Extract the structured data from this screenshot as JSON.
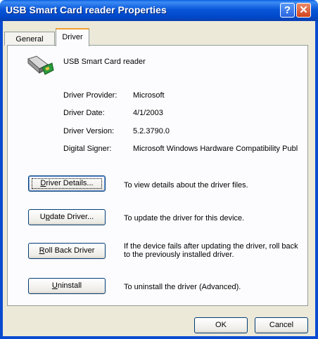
{
  "window": {
    "title": "USB Smart Card reader Properties"
  },
  "titlebar": {
    "help_glyph": "?",
    "close_glyph": "✕"
  },
  "tabs": [
    {
      "label": "General",
      "selected": false
    },
    {
      "label": "Driver",
      "selected": true
    }
  ],
  "device": {
    "icon": "smart-card-reader-icon",
    "name": "USB Smart Card reader"
  },
  "properties": [
    {
      "label": "Driver Provider:",
      "value": "Microsoft"
    },
    {
      "label": "Driver Date:",
      "value": "4/1/2003"
    },
    {
      "label": "Driver Version:",
      "value": "5.2.3790.0"
    },
    {
      "label": "Digital Signer:",
      "value": "Microsoft Windows Hardware Compatibility Publ"
    }
  ],
  "actions": [
    {
      "button_pre": "",
      "button_u": "D",
      "button_post": "river Details...",
      "description": "To view details about the driver files."
    },
    {
      "button_pre": "U",
      "button_u": "p",
      "button_post": "date Driver...",
      "description": "To update the driver for this device."
    },
    {
      "button_pre": "",
      "button_u": "R",
      "button_post": "oll Back Driver",
      "description": "If the device fails after updating the driver, roll back to the previously installed driver."
    },
    {
      "button_pre": "",
      "button_u": "U",
      "button_post": "ninstall",
      "description": "To uninstall the driver (Advanced)."
    }
  ],
  "dialog_buttons": {
    "ok": "OK",
    "cancel": "Cancel"
  },
  "colors": {
    "titlebar": "#0a5fe0",
    "dialog_bg": "#ece9d8",
    "close": "#d2431c",
    "tab_highlight": "#f0a030"
  }
}
